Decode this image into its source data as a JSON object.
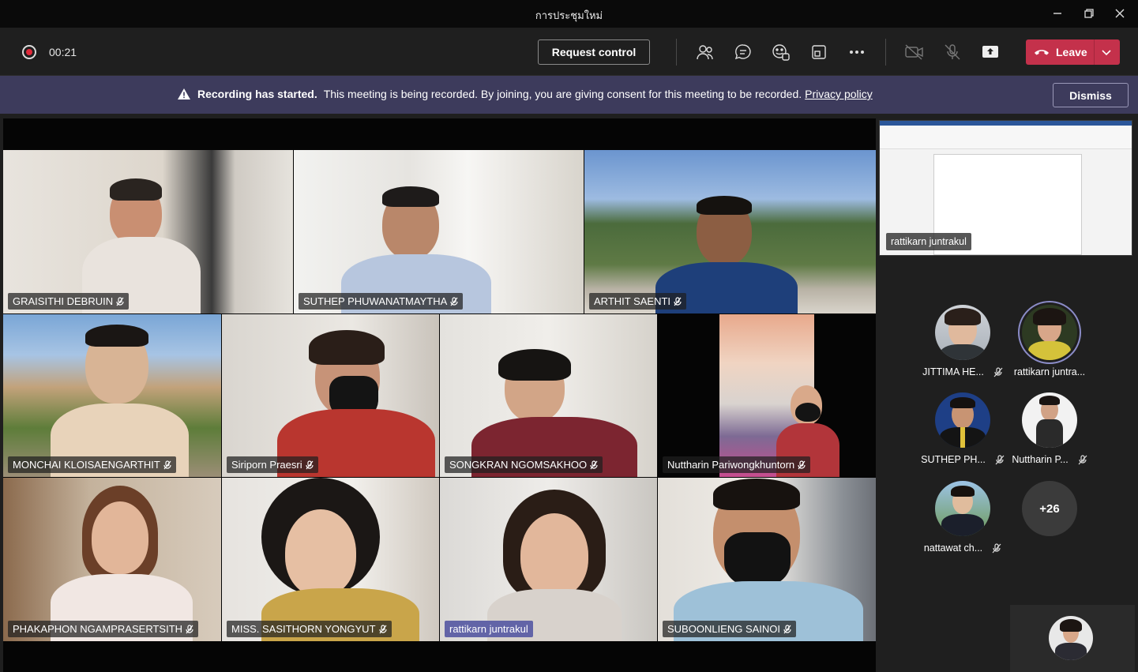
{
  "window": {
    "title": "การประชุมใหม่"
  },
  "toolbar": {
    "timer": "00:21",
    "request_control": "Request control",
    "leave_label": "Leave",
    "icons": [
      "people-icon",
      "chat-icon",
      "reactions-icon",
      "share-tray-icon",
      "more-options-icon",
      "camera-off-icon",
      "mic-off-icon",
      "share-screen-icon"
    ]
  },
  "banner": {
    "title": "Recording has started.",
    "message": "This meeting is being recorded. By joining, you are giving consent for this meeting to be recorded.",
    "link": "Privacy policy",
    "dismiss": "Dismiss"
  },
  "video_tiles": [
    {
      "name": "GRAISITHI DEBRUIN"
    },
    {
      "name": "SUTHEP PHUWANATMAYTHA"
    },
    {
      "name": "ARTHIT SAENTI"
    },
    {
      "name": "MONCHAI KLOISAENGARTHIT"
    },
    {
      "name": "Siriporn Praesri"
    },
    {
      "name": "SONGKRAN NGOMSAKHOO"
    },
    {
      "name": "Nuttharin Pariwongkhuntorn"
    },
    {
      "name": "PHAKAPHON NGAMPRASERTSITH"
    },
    {
      "name": "MISS. SASITHORN YONGYUT"
    },
    {
      "name": "rattikarn juntrakul"
    },
    {
      "name": "SUBOONLIENG SAINOI"
    }
  ],
  "screen_share": {
    "presenter": "rattikarn juntrakul"
  },
  "participants": [
    {
      "name": "JITTIMA HE...",
      "muted": true
    },
    {
      "name": "rattikarn juntra...",
      "muted": false,
      "speaking": true
    },
    {
      "name": "SUTHEP PH...",
      "muted": true
    },
    {
      "name": "Nuttharin P...",
      "muted": true
    },
    {
      "name": "nattawat ch...",
      "muted": true
    }
  ],
  "more_participants": "+26"
}
